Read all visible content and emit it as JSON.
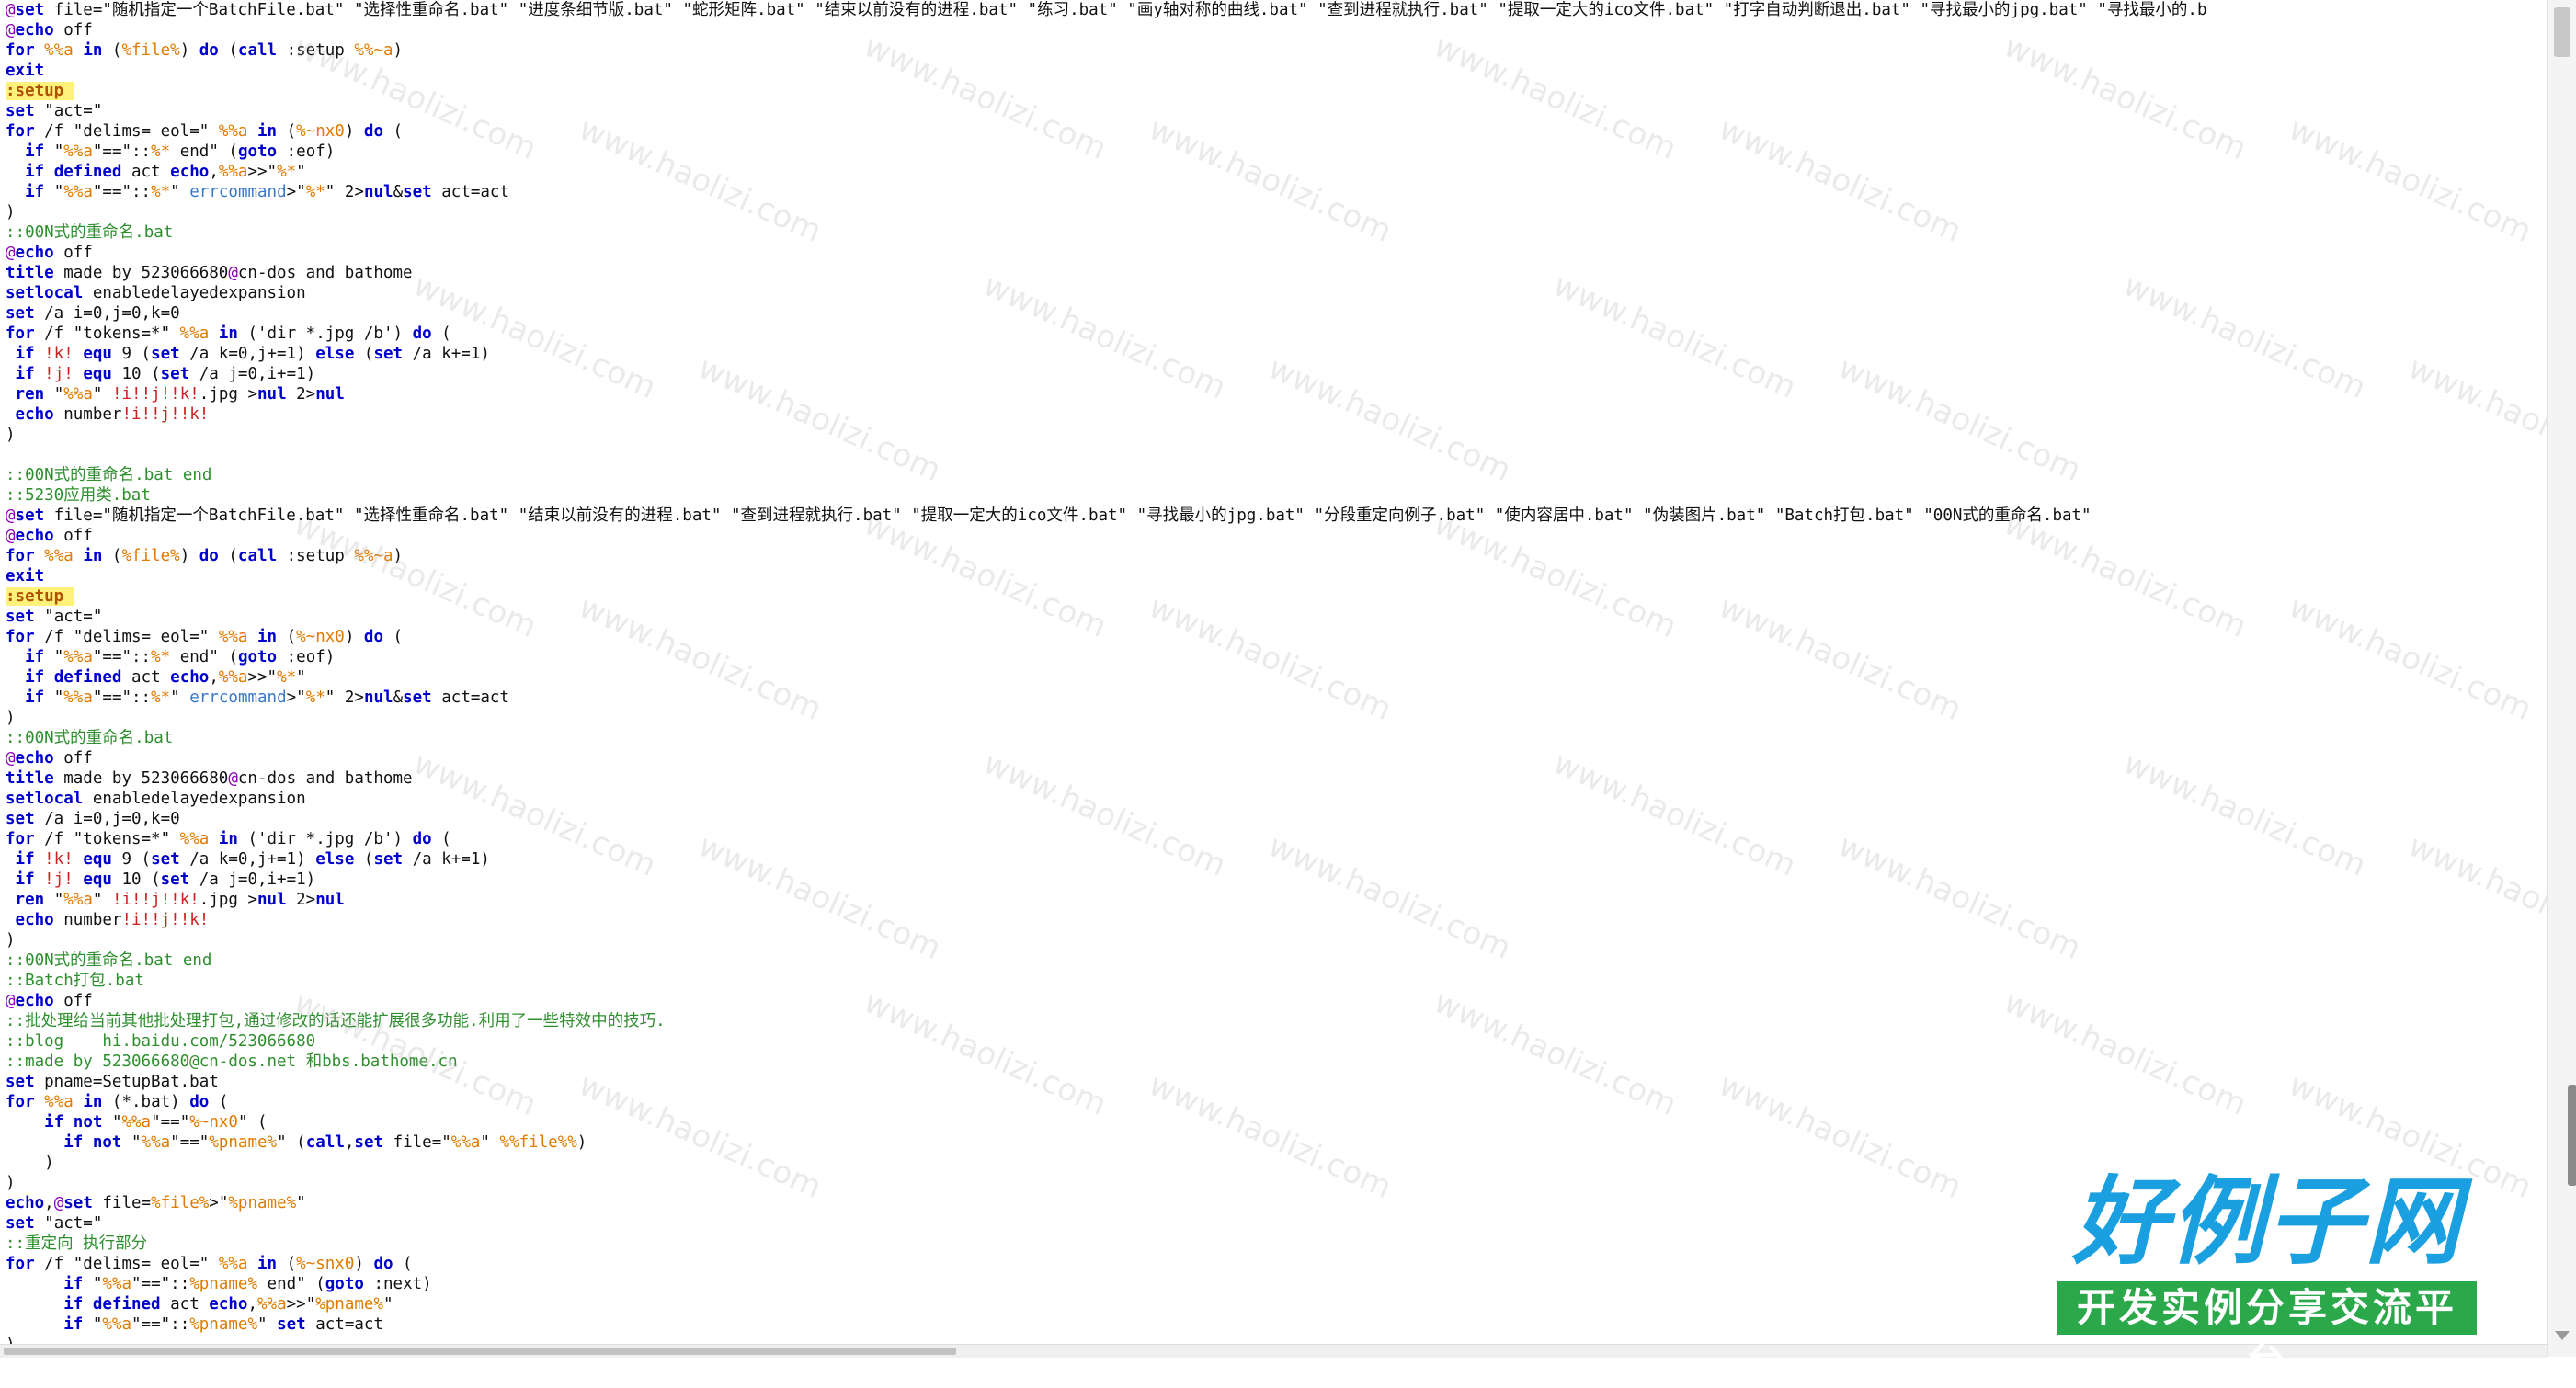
{
  "watermark": "www.haolizi.com",
  "logo": {
    "title": "好例子网",
    "subtitle": "开发实例分享交流平台"
  },
  "lines": [
    "@set file=\"随机指定一个BatchFile.bat\" \"选择性重命名.bat\" \"进度条细节版.bat\" \"蛇形矩阵.bat\" \"结束以前没有的进程.bat\" \"练习.bat\" \"画y轴对称的曲线.bat\" \"查到进程就执行.bat\" \"提取一定大的ico文件.bat\" \"打字自动判断退出.bat\" \"寻找最小的jpg.bat\" \"寻找最小的.b",
    "@echo off",
    "for %%a in (%file%) do (call :setup %%~a)",
    "exit",
    ":setup",
    "set \"act=\"",
    "for /f \"delims= eol=\" %%a in (%~nx0) do (",
    "  if \"%%a\"==\"::%* end\" (goto :eof)",
    "  if defined act echo,%%a>>\"%*\"",
    "  if \"%%a\"==\"::%*\" errcommand>\"%*\" 2>nul&set act=act",
    ")",
    "::00N式的重命名.bat",
    "@echo off",
    "title made by 523066680@cn-dos and bathome",
    "setlocal enabledelayedexpansion",
    "set /a i=0,j=0,k=0",
    "for /f \"tokens=*\" %%a in ('dir *.jpg /b') do (",
    " if !k! equ 9 (set /a k=0,j+=1) else (set /a k+=1)",
    " if !j! equ 10 (set /a j=0,i+=1)",
    " ren \"%%a\" !i!!j!!k!.jpg >nul 2>nul",
    " echo number!i!!j!!k!",
    ")",
    "",
    "::00N式的重命名.bat end",
    "::5230应用类.bat",
    "@set file=\"随机指定一个BatchFile.bat\" \"选择性重命名.bat\" \"结束以前没有的进程.bat\" \"查到进程就执行.bat\" \"提取一定大的ico文件.bat\" \"寻找最小的jpg.bat\" \"分段重定向例子.bat\" \"使内容居中.bat\" \"伪装图片.bat\" \"Batch打包.bat\" \"00N式的重命名.bat\"",
    "@echo off",
    "for %%a in (%file%) do (call :setup %%~a)",
    "exit",
    ":setup",
    "set \"act=\"",
    "for /f \"delims= eol=\" %%a in (%~nx0) do (",
    "  if \"%%a\"==\"::%* end\" (goto :eof)",
    "  if defined act echo,%%a>>\"%*\"",
    "  if \"%%a\"==\"::%*\" errcommand>\"%*\" 2>nul&set act=act",
    ")",
    "::00N式的重命名.bat",
    "@echo off",
    "title made by 523066680@cn-dos and bathome",
    "setlocal enabledelayedexpansion",
    "set /a i=0,j=0,k=0",
    "for /f \"tokens=*\" %%a in ('dir *.jpg /b') do (",
    " if !k! equ 9 (set /a k=0,j+=1) else (set /a k+=1)",
    " if !j! equ 10 (set /a j=0,i+=1)",
    " ren \"%%a\" !i!!j!!k!.jpg >nul 2>nul",
    " echo number!i!!j!!k!",
    ")",
    "::00N式的重命名.bat end",
    "::Batch打包.bat",
    "@echo off",
    "::批处理给当前其他批处理打包,通过修改的话还能扩展很多功能.利用了一些特效中的技巧.",
    "::blog    hi.baidu.com/523066680",
    "::made by 523066680@cn-dos.net 和bbs.bathome.cn",
    "set pname=SetupBat.bat",
    "for %%a in (*.bat) do (",
    "    if not \"%%a\"==\"%~nx0\" (",
    "      if not \"%%a\"==\"%pname%\" (call,set file=\"%%a\" %%file%%)",
    "    )",
    ")",
    "echo,@set file=%file%>\"%pname%\"",
    "set \"act=\"",
    "::重定向 执行部分",
    "for /f \"delims= eol=\" %%a in (%~snx0) do (",
    "      if \"%%a\"==\"::%pname% end\" (goto :next)",
    "      if defined act echo,%%a>>\"%pname%\"",
    "      if \"%%a\"==\"::%pname%\" set act=act",
    ")"
  ]
}
